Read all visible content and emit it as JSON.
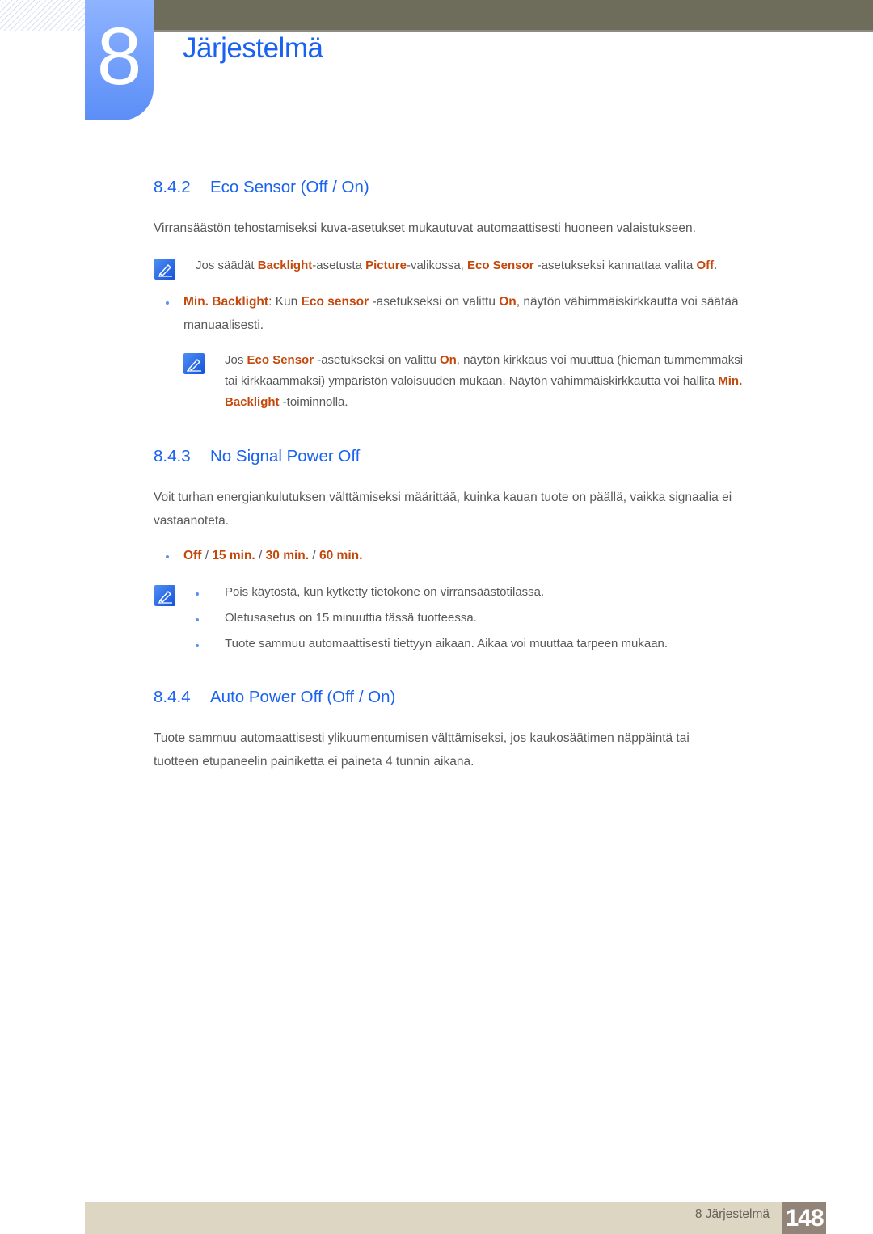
{
  "header": {
    "chapter_number": "8",
    "chapter_title": "Järjestelmä"
  },
  "colors": {
    "heading_blue": "#1a62f0",
    "highlight_orange": "#c4480c",
    "header_bar": "#6e6c5a",
    "footer_band": "#dcd6c2",
    "page_box": "#928479"
  },
  "sections": [
    {
      "number": "8.4.2",
      "title": "Eco Sensor (Off / On)",
      "intro": "Virransäästön tehostamiseksi kuva-asetukset mukautuvat automaattisesti huoneen valaistukseen.",
      "note": {
        "icon": "note-pencil-icon",
        "t1": "Jos säädät ",
        "h1": "Backlight",
        "t2": "-asetusta ",
        "h2": "Picture",
        "t3": "-valikossa, ",
        "h3": "Eco Sensor",
        "t4": " -asetukseksi kannattaa valita ",
        "h4": "Off",
        "t5": "."
      },
      "bullet": {
        "h1": "Min. Backlight",
        "t1": ": Kun ",
        "h2": "Eco sensor",
        "t2": " -asetukseksi on valittu ",
        "h3": "On",
        "t3": ", näytön vähimmäiskirkkautta voi säätää",
        "line2": "manuaalisesti."
      },
      "subnote": {
        "icon": "note-pencil-icon",
        "t1": "Jos ",
        "h1": "Eco Sensor",
        "t2": " -asetukseksi on valittu ",
        "h2": "On",
        "t3": ", näytön kirkkaus voi muuttua (hieman tummemmaksi",
        "line2_text": "tai kirkkaammaksi) ympäristön valoisuuden mukaan. Näytön vähimmäiskirkkautta voi hallita ",
        "line2_hl": "Min.",
        "line3_hl": "Backlight",
        "line3_text": " -toiminnolla."
      }
    },
    {
      "number": "8.4.3",
      "title": "No Signal Power Off",
      "intro_line1": "Voit turhan energiankulutuksen välttämiseksi määrittää, kuinka kauan tuote on päällä, vaikka signaalia ei",
      "intro_line2": "vastaanoteta.",
      "options": {
        "o1": "Off",
        "sep": " / ",
        "o2": "15 min.",
        "o3": "30 min.",
        "o4": "60 min."
      },
      "notes": [
        "Pois käytöstä, kun kytketty tietokone on virransäästötilassa.",
        "Oletusasetus on 15 minuuttia tässä tuotteessa.",
        "Tuote sammuu automaattisesti tiettyyn aikaan. Aikaa voi muuttaa tarpeen mukaan."
      ]
    },
    {
      "number": "8.4.4",
      "title": "Auto Power Off (Off / On)",
      "intro_line1": "Tuote sammuu automaattisesti ylikuumentumisen välttämiseksi, jos kaukosäätimen näppäintä tai",
      "intro_line2": "tuotteen etupaneelin painiketta ei paineta 4 tunnin aikana."
    }
  ],
  "footer": {
    "chapter_label": "8 Järjestelmä",
    "page_number": "148"
  }
}
